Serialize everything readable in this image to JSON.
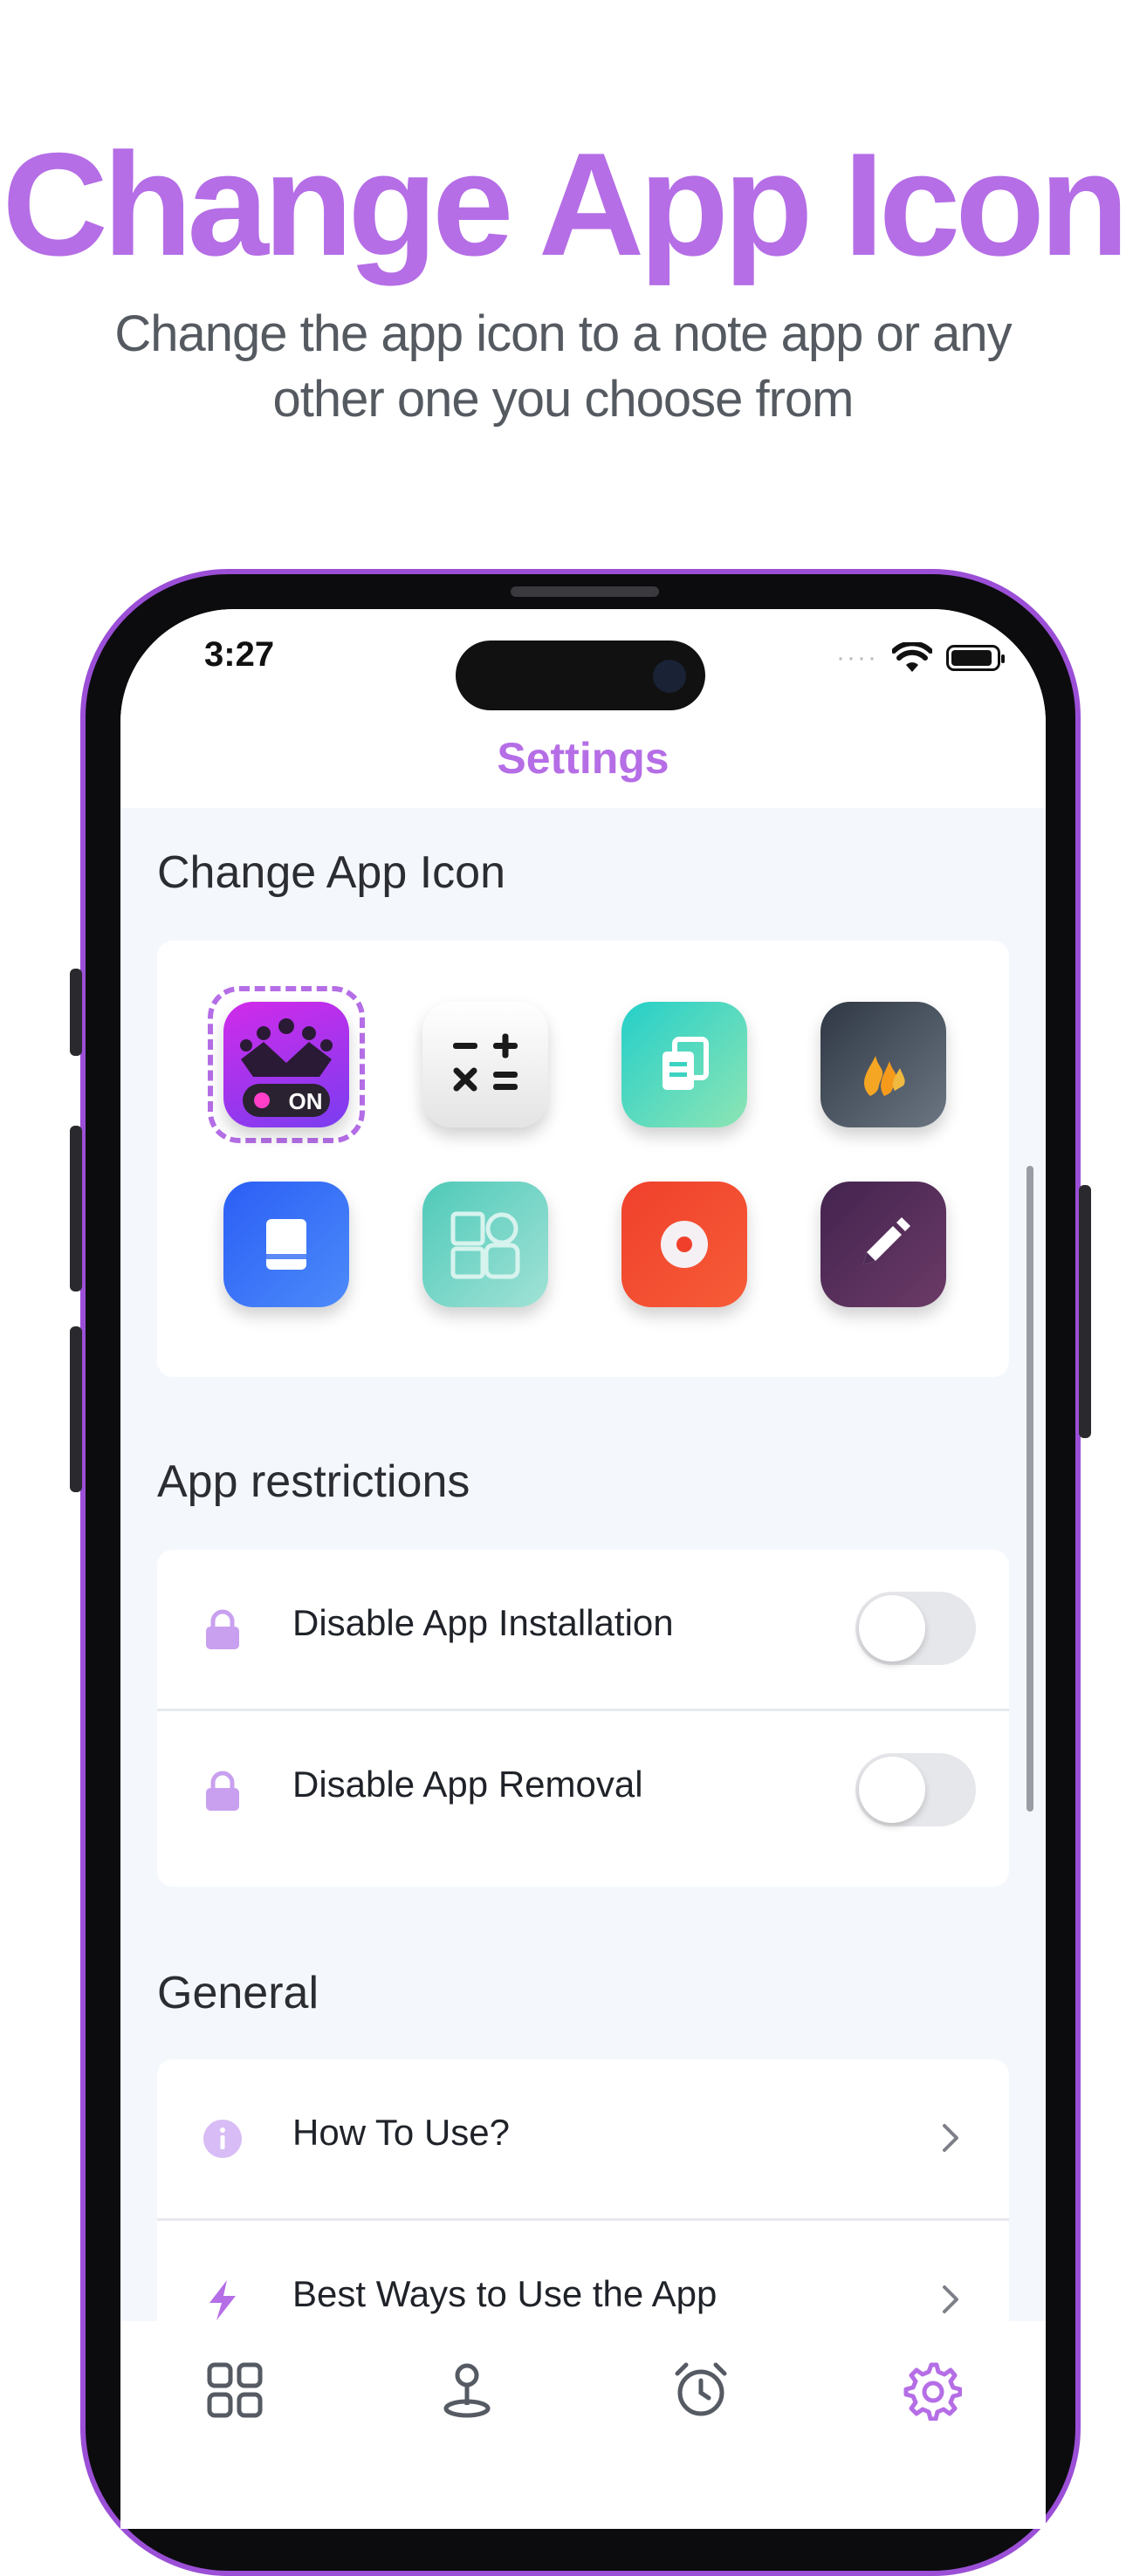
{
  "hero": {
    "title": "Change App Icon",
    "subtitle_line1": "Change the app icon to a note app or any",
    "subtitle_line2": "other one you choose from"
  },
  "status_bar": {
    "time": "3:27",
    "signal_text": "····"
  },
  "nav": {
    "title": "Settings"
  },
  "change_icon": {
    "section_title": "Change App Icon",
    "selected_badge": "ON",
    "icons": [
      {
        "name": "app-icon-default",
        "color": "#c02cf0",
        "selected": true
      },
      {
        "name": "calculator-icon",
        "color": "#f1f1f1"
      },
      {
        "name": "copy-notes-icon",
        "color": "#34d3c2"
      },
      {
        "name": "flame-icon",
        "color": "#3a4351"
      },
      {
        "name": "book-icon",
        "color": "#2f6cf6"
      },
      {
        "name": "shapes-icon",
        "color": "#5ccfc1"
      },
      {
        "name": "record-icon",
        "color": "#f2472c"
      },
      {
        "name": "pencil-icon",
        "color": "#4d2a55"
      }
    ]
  },
  "restrictions": {
    "section_title": "App restrictions",
    "items": [
      {
        "label": "Disable App Installation",
        "enabled": false
      },
      {
        "label": "Disable App Removal",
        "enabled": false
      }
    ]
  },
  "general": {
    "section_title": "General",
    "items": [
      {
        "label": "How To Use?"
      },
      {
        "label": "Best Ways to Use the App"
      }
    ]
  },
  "tabs": [
    {
      "name": "tab-apps",
      "active": false
    },
    {
      "name": "tab-location",
      "active": false
    },
    {
      "name": "tab-alarm",
      "active": false
    },
    {
      "name": "tab-settings",
      "active": true
    }
  ],
  "colors": {
    "accent": "#b56ee6",
    "frame_border": "#9b4fd6",
    "inactive_icon": "#555a63"
  }
}
